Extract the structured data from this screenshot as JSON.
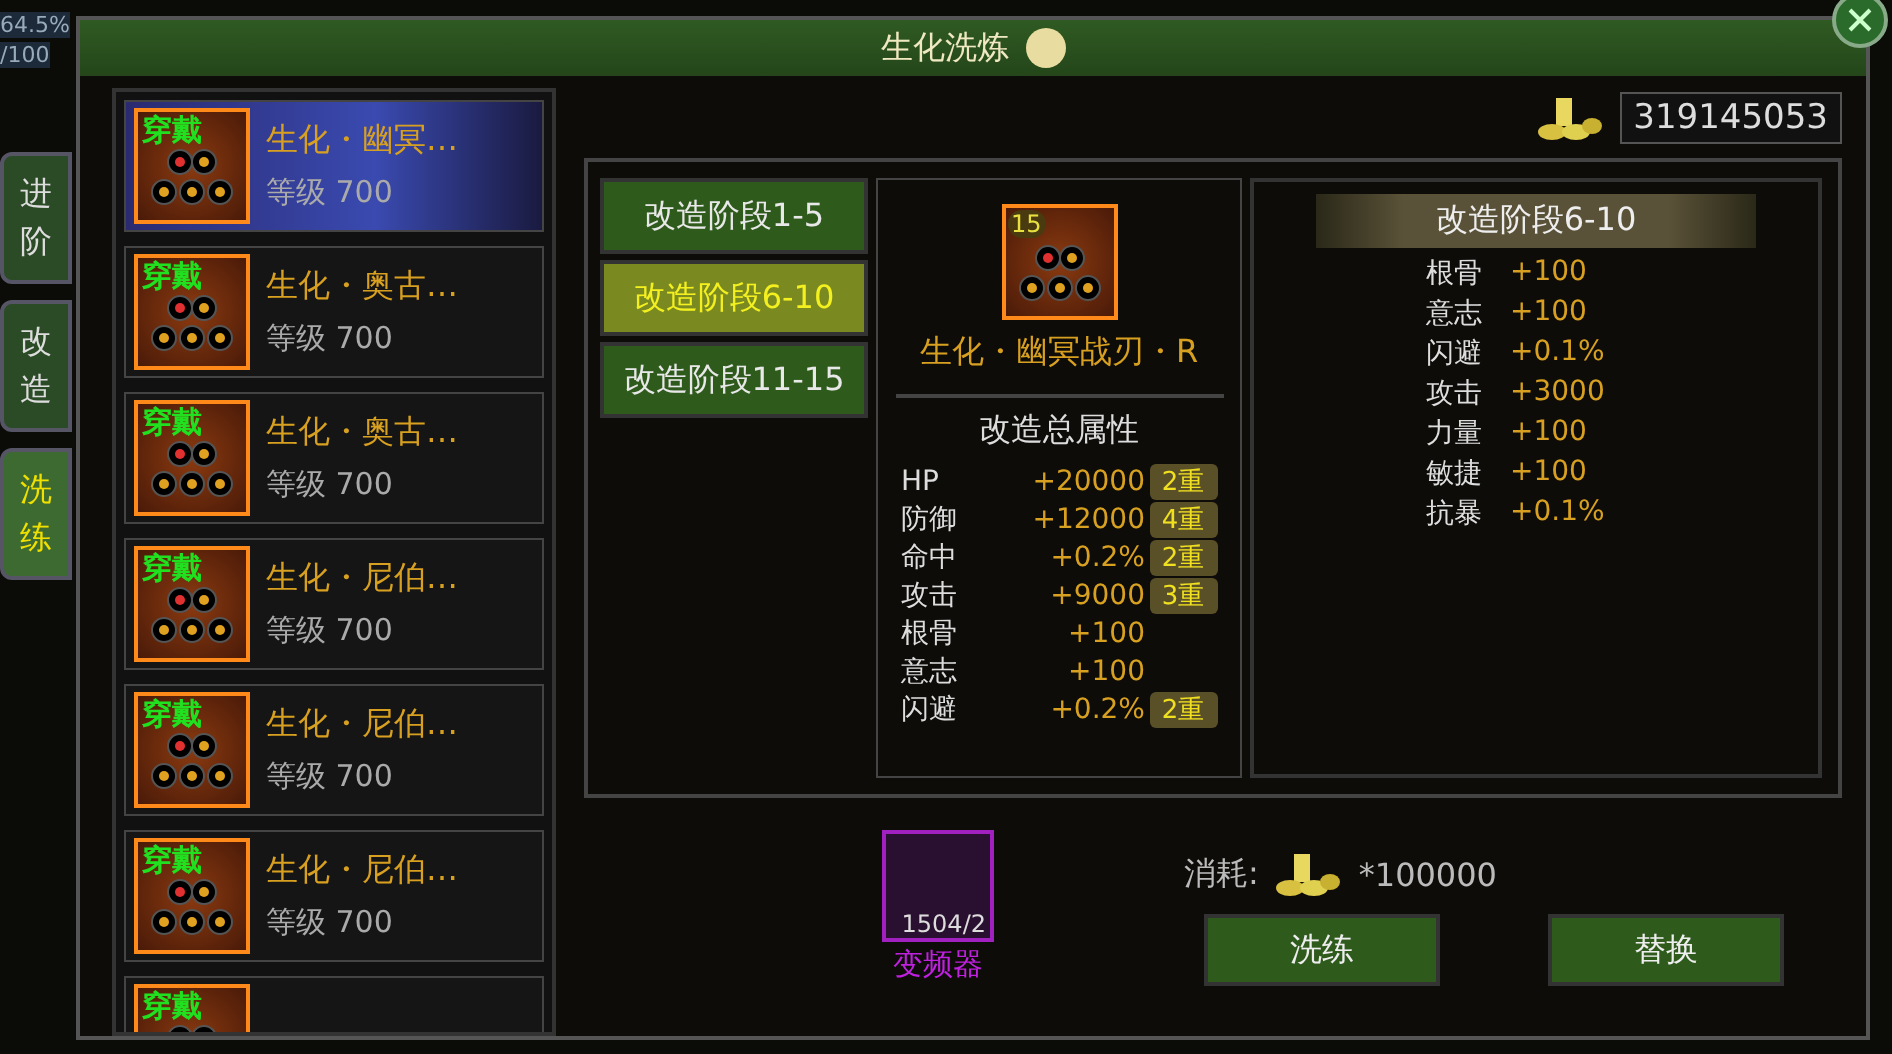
{
  "background_fragments": [
    "64.5%",
    "/100"
  ],
  "side_tabs": [
    {
      "label": "进阶",
      "selected": false
    },
    {
      "label": "改造",
      "selected": false
    },
    {
      "label": "洗练",
      "selected": true
    }
  ],
  "window": {
    "title": "生化洗炼"
  },
  "coins": "319145053",
  "items": [
    {
      "badge": "穿戴",
      "name": "生化・幽冥…",
      "level": "等级 700",
      "selected": true
    },
    {
      "badge": "穿戴",
      "name": "生化・奥古…",
      "level": "等级 700",
      "selected": false
    },
    {
      "badge": "穿戴",
      "name": "生化・奥古…",
      "level": "等级 700",
      "selected": false
    },
    {
      "badge": "穿戴",
      "name": "生化・尼伯…",
      "level": "等级 700",
      "selected": false
    },
    {
      "badge": "穿戴",
      "name": "生化・尼伯…",
      "level": "等级 700",
      "selected": false
    },
    {
      "badge": "穿戴",
      "name": "生化・尼伯…",
      "level": "等级 700",
      "selected": false
    },
    {
      "badge": "穿戴",
      "selected": false
    }
  ],
  "stages": [
    {
      "label": "改造阶段1-5",
      "selected": false
    },
    {
      "label": "改造阶段6-10",
      "selected": true
    },
    {
      "label": "改造阶段11-15",
      "selected": false
    }
  ],
  "equipment": {
    "badge": "15",
    "name": "生化・幽冥战刃・R",
    "section_title": "改造总属性",
    "attributes": [
      {
        "name": "HP",
        "value": "+20000",
        "tier": "2重"
      },
      {
        "name": "防御",
        "value": "+12000",
        "tier": "4重"
      },
      {
        "name": "命中",
        "value": "+0.2%",
        "tier": "2重"
      },
      {
        "name": "攻击",
        "value": "+9000",
        "tier": "3重"
      },
      {
        "name": "根骨",
        "value": "+100"
      },
      {
        "name": "意志",
        "value": "+100"
      },
      {
        "name": "闪避",
        "value": "+0.2%",
        "tier": "2重"
      }
    ]
  },
  "stage_detail": {
    "title": "改造阶段6-10",
    "attributes": [
      {
        "name": "根骨",
        "value": "+100"
      },
      {
        "name": "意志",
        "value": "+100"
      },
      {
        "name": "闪避",
        "value": "+0.1%"
      },
      {
        "name": "攻击",
        "value": "+3000"
      },
      {
        "name": "力量",
        "value": "+100"
      },
      {
        "name": "敏捷",
        "value": "+100"
      },
      {
        "name": "抗暴",
        "value": "+0.1%"
      }
    ]
  },
  "material": {
    "count": "1504/2",
    "name": "变频器"
  },
  "cost": {
    "label": "消耗:",
    "amount": "*100000"
  },
  "buttons": [
    "洗练",
    "替换"
  ]
}
